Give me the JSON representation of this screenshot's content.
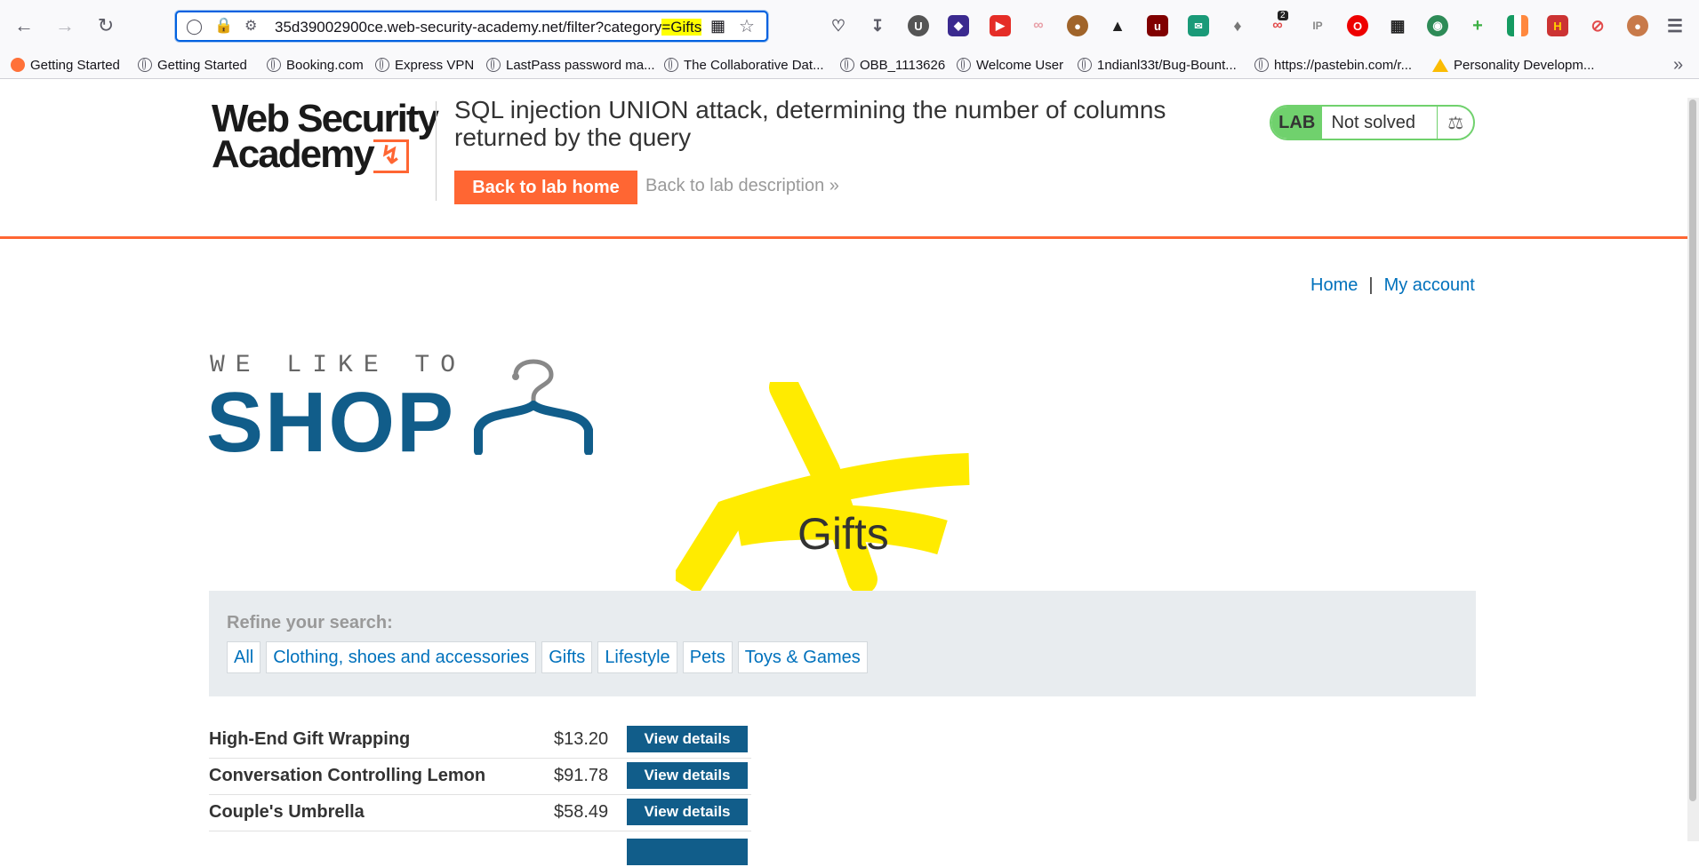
{
  "browser": {
    "url_prefix": "35d39002900ce.web-security-academy.net/filter?category",
    "url_highlight": "=Gifts",
    "extension_badge_count": "2",
    "bookmarks": [
      "Getting Started",
      "Getting Started",
      "Booking.com",
      "Express VPN",
      "LastPass password ma...",
      "The Collaborative Dat...",
      "OBB_1113626",
      "Welcome User",
      "1ndianl33t/Bug-Bount...",
      "https://pastebin.com/r...",
      "Personality Developm..."
    ]
  },
  "academy": {
    "logo_line1": "Web Security",
    "logo_line2": "Academy",
    "lab_title": "SQL injection UNION attack, determining the number of columns returned by the query",
    "back_home": "Back to lab home",
    "back_description": "Back to lab description",
    "lab_label": "LAB",
    "lab_status": "Not solved"
  },
  "shop": {
    "nav": {
      "home": "Home",
      "separator": "|",
      "account": "My account"
    },
    "tagline": "WE LIKE TO",
    "brand": "SHOP",
    "category_title": "Gifts",
    "refine_label": "Refine your search:",
    "filters": [
      "All",
      "Clothing, shoes and accessories",
      "Gifts",
      "Lifestyle",
      "Pets",
      "Toys & Games"
    ],
    "products": [
      {
        "name": "High-End Gift Wrapping",
        "price": "$13.20",
        "button": "View details"
      },
      {
        "name": "Conversation Controlling Lemon",
        "price": "$91.78",
        "button": "View details"
      },
      {
        "name": "Couple's Umbrella",
        "price": "$58.49",
        "button": "View details"
      }
    ]
  },
  "colors": {
    "accent_orange": "#ff6633",
    "brand_blue": "#115d8a",
    "link_blue": "#0071bc",
    "lab_green": "#70d16d",
    "highlight_yellow": "#ffff00"
  }
}
